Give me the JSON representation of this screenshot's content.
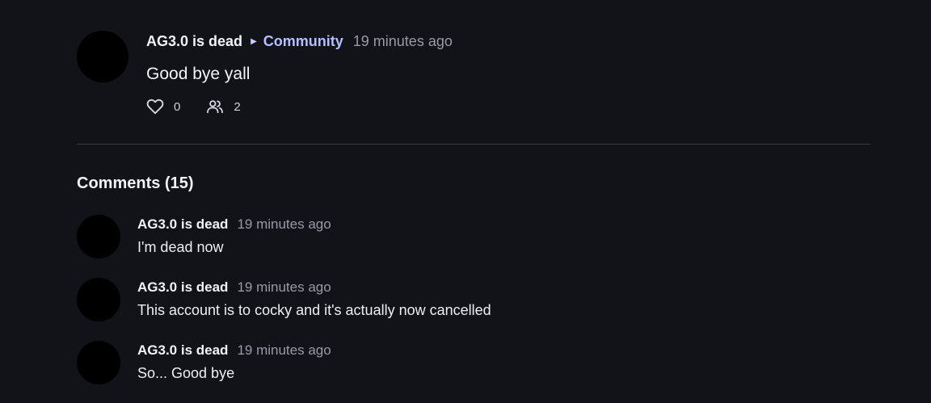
{
  "post": {
    "author": "AG3.0 is dead",
    "community": "Community",
    "time": "19 minutes ago",
    "text": "Good bye yall",
    "likes": "0",
    "members": "2"
  },
  "comments_title": "Comments (15)",
  "comments": [
    {
      "author": "AG3.0 is dead",
      "time": "19 minutes ago",
      "text": "I'm dead now"
    },
    {
      "author": "AG3.0 is dead",
      "time": "19 minutes ago",
      "text": "This account is to cocky and it's actually now cancelled"
    },
    {
      "author": "AG3.0 is dead",
      "time": "19 minutes ago",
      "text": "So... Good bye"
    }
  ],
  "colors": {
    "background": "#121219",
    "community_link": "#b6c0ff",
    "muted_text": "#9a9aa6"
  },
  "icons": [
    "heart-icon",
    "people-icon",
    "caret-right-icon"
  ]
}
